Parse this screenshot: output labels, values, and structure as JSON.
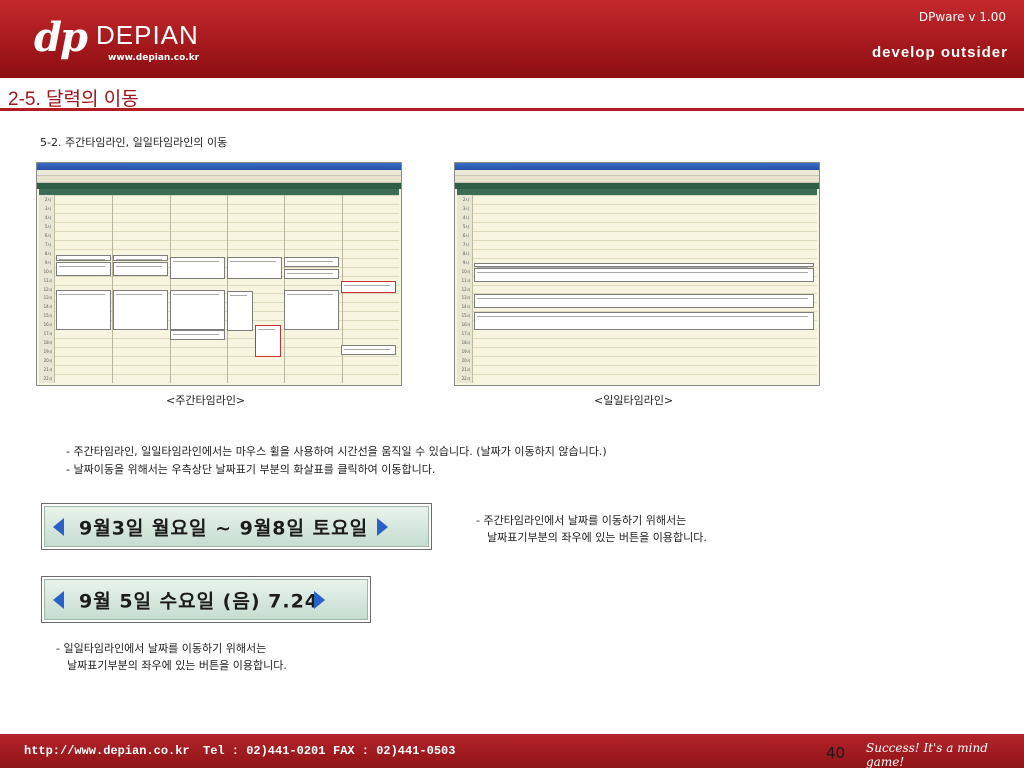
{
  "header": {
    "logo_mark": "dp",
    "logo_word": "DEPIAN",
    "logo_url": "www.depian.co.kr",
    "version": "DPware v 1.00",
    "tagline": "develop outsider"
  },
  "page": {
    "title": "2-5. 달력의 이동",
    "subtitle": "5-2. 주간타임라인, 일일타임라인의 이동"
  },
  "screenshots": {
    "week_caption": "<주간타임라인>",
    "day_caption": "<일일타임라인>",
    "hours": [
      "2시",
      "3시",
      "4시",
      "5시",
      "6시",
      "7시",
      "8시",
      "9시",
      "10시",
      "11시",
      "12시",
      "13시",
      "14시",
      "15시",
      "16시",
      "17시",
      "18시",
      "19시",
      "20시",
      "21시",
      "22시"
    ]
  },
  "notes": {
    "line1": "- 주간타임라인, 일일타임라인에서는 마우스 휠을 사용하여 시간선을 움직일 수 있습니다. (날짜가 이동하지 않습니다.)",
    "line2": "- 날짜이동을 위해서는 우측상단 날짜표기 부분의 화살표를 클릭하여 이동합니다."
  },
  "week_bar": {
    "label": "9월3일 월요일 ~ 9월8일 토요일",
    "note_line1": "- 주간타임라인에서 날짜를 이동하기 위해서는",
    "note_line2": "날짜표기부분의 좌우에 있는 버튼을 이용합니다."
  },
  "day_bar": {
    "label": "9월 5일 수요일 (음) 7.24",
    "note_line1": "- 일일타임라인에서 날짜를 이동하기 위해서는",
    "note_line2": "날짜표기부분의 좌우에 있는 버튼을 이용합니다."
  },
  "footer": {
    "url": "http://www.depian.co.kr",
    "tel": "Tel : 02)441-0201",
    "fax": "FAX : 02)441-0503",
    "page_number": "40",
    "slogan": "Success! It's a mind game!"
  },
  "colors": {
    "brand_red": "#a3171b",
    "arrow_blue": "#2a61c9",
    "bar_green": "#c6ddd0"
  }
}
